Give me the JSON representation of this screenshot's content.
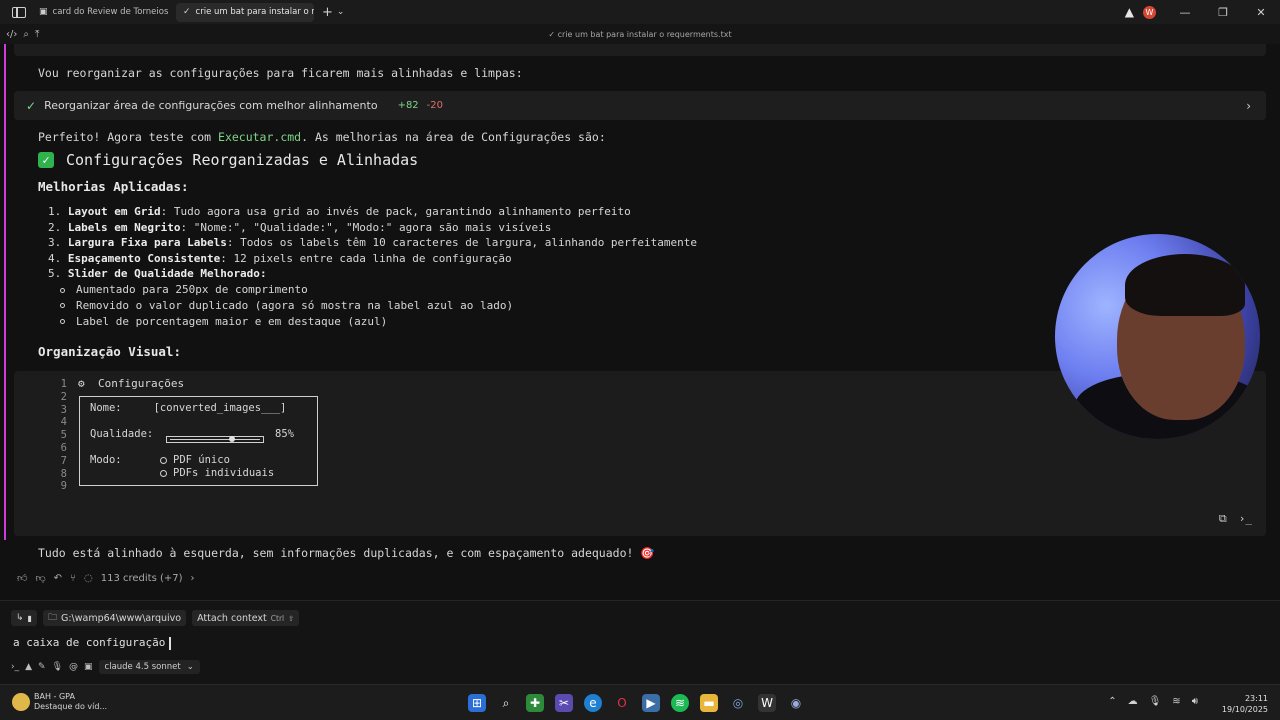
{
  "titlebar": {
    "tabs": [
      {
        "label": "card do Review de Torneios",
        "active": false
      },
      {
        "label": "crie um bat para instalar o req",
        "active": true
      }
    ],
    "new_tab": "+",
    "dropdown": "⌄",
    "user_initial": "W",
    "window_buttons": [
      "—",
      "❐",
      "✕"
    ]
  },
  "subbar": {
    "title": "crie um bat para instalar o requerments.txt"
  },
  "chat": {
    "intro": "Vou reorganizar as configurações para ficarem mais alinhadas e limpas:",
    "change": {
      "label": "Reorganizar área de configurações com melhor alinhamento",
      "added": "+82",
      "removed": "-20"
    },
    "result_prefix": "Perfeito! Agora teste com ",
    "result_code": "Executar.cmd",
    "result_suffix": ". As melhorias na área de Configurações são:",
    "heading": "Configurações Reorganizadas e Alinhadas",
    "improvements_title": "Melhorias Aplicadas:",
    "improvements": [
      {
        "num": "1.",
        "bold": "Layout em Grid",
        "text": ": Tudo agora usa grid ao invés de pack, garantindo alinhamento perfeito"
      },
      {
        "num": "2.",
        "bold": "Labels em Negrito",
        "text": ": \"Nome:\", \"Qualidade:\", \"Modo:\" agora são mais visíveis"
      },
      {
        "num": "3.",
        "bold": "Largura Fixa para Labels",
        "text": ": Todos os labels têm 10 caracteres de largura, alinhando perfeitamente"
      },
      {
        "num": "4.",
        "bold": "Espaçamento Consistente",
        "text": ": 12 pixels entre cada linha de configuração"
      },
      {
        "num": "5.",
        "bold": "Slider de Qualidade Melhorado",
        "text": ":"
      }
    ],
    "subitems": [
      "Aumentado para 250px de comprimento",
      "Removido o valor duplicado (agora só mostra na label azul ao lado)",
      "Label de porcentagem maior e em destaque (azul)"
    ],
    "visual_title": "Organização Visual:",
    "code": {
      "line_numbers": [
        "1",
        "2",
        "3",
        "4",
        "5",
        "6",
        "7",
        "8",
        "9"
      ],
      "title": "Configurações",
      "nome_label": "Nome:",
      "nome_value": "[converted_images___]",
      "qualidade_label": "Qualidade:",
      "slider_open": "[",
      "slider_close": "]",
      "slider_value": 0.85,
      "percent": "85%",
      "modo_label": "Modo:",
      "options": [
        "PDF único",
        "PDFs individuais"
      ]
    },
    "closing": "Tudo está alinhado à esquerda, sem informações duplicadas, e com espaçamento adequado! 🎯",
    "credits": "113 credits (+7)"
  },
  "composer": {
    "path": "G:\\wamp64\\www\\arquivo",
    "attach": "Attach context",
    "attach_kbd": "Ctrl",
    "attach_kbd2": "⇧",
    "input_value": "a caixa de configuração",
    "model": "claude 4.5 sonnet"
  },
  "taskbar": {
    "weather_title": "BAH - GPA",
    "weather_sub": "Destaque do víd...",
    "time": "23:11",
    "date": "19/10/2025"
  },
  "colors": {
    "accent": "#d33bd6",
    "added": "#7fd48a",
    "removed": "#e06c6c",
    "check": "#2fb24b"
  }
}
